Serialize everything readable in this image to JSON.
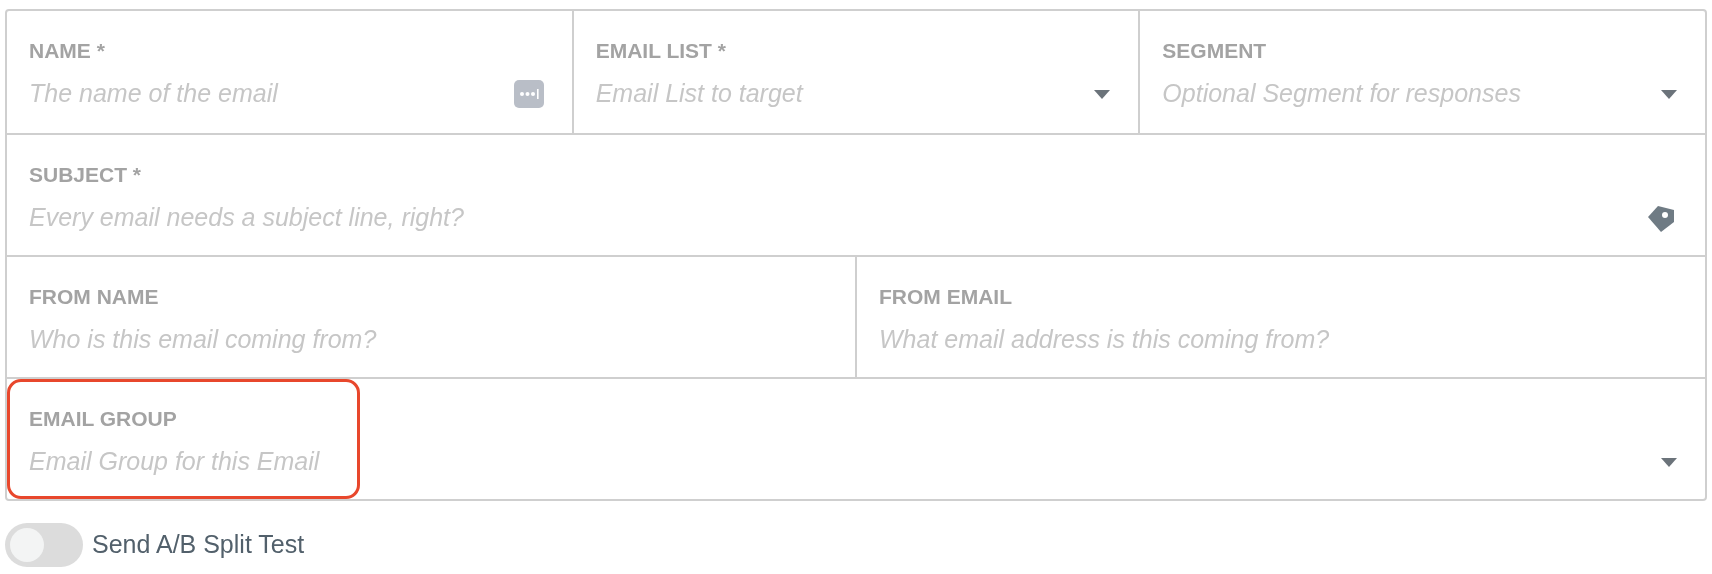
{
  "form_rows": [
    {
      "fields": [
        {
          "label": "NAME *",
          "placeholder": "The name of the email",
          "kind": "more",
          "highlighted": false
        },
        {
          "label": "EMAIL LIST *",
          "placeholder": "Email List to target",
          "kind": "select",
          "highlighted": false
        },
        {
          "label": "SEGMENT",
          "placeholder": "Optional Segment for responses",
          "kind": "select",
          "highlighted": false
        }
      ]
    },
    {
      "fields": [
        {
          "label": "SUBJECT *",
          "placeholder": "Every email needs a subject line, right?",
          "kind": "tagged",
          "highlighted": false
        }
      ]
    },
    {
      "fields": [
        {
          "label": "FROM NAME",
          "placeholder": "Who is this email coming from?",
          "kind": "text",
          "highlighted": false
        },
        {
          "label": "FROM EMAIL",
          "placeholder": "What email address is this coming from?",
          "kind": "text",
          "highlighted": false
        }
      ]
    },
    {
      "fields": [
        {
          "label": "EMAIL GROUP",
          "placeholder": "Email Group for this Email",
          "kind": "select",
          "highlighted": true
        }
      ]
    }
  ],
  "split_test": {
    "label": "Send A/B Split Test",
    "on": false
  }
}
